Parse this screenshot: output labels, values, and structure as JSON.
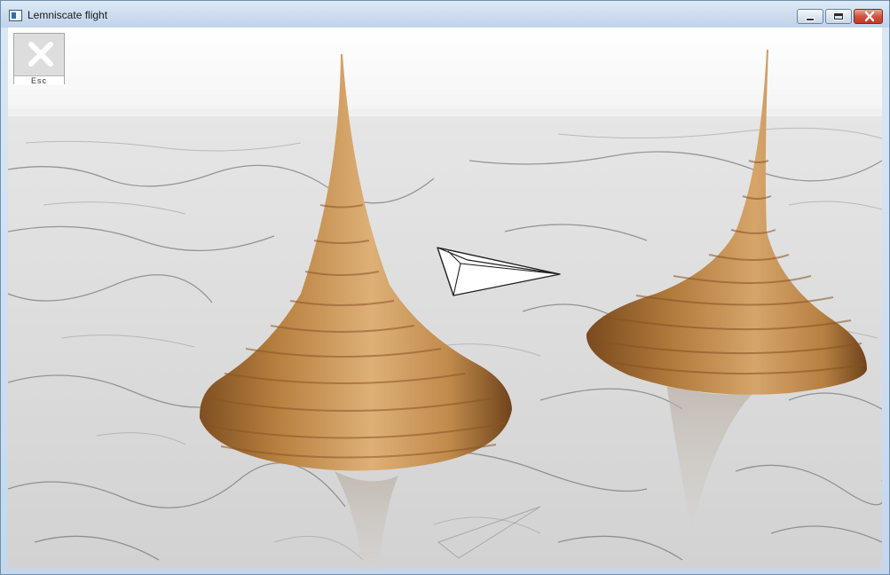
{
  "window": {
    "title": "Lemniscate flight",
    "controls": {
      "minimize": "minimize-icon",
      "maximize": "maximize-icon",
      "close": "close-icon"
    }
  },
  "overlay": {
    "esc_button": {
      "icon": "close-x-icon",
      "label": "Esc"
    }
  },
  "scene": {
    "sky_color": "#ffffff",
    "floor_texture": "white marble",
    "wood_color": "#c48c4e",
    "plane_color": "#ffffff"
  }
}
